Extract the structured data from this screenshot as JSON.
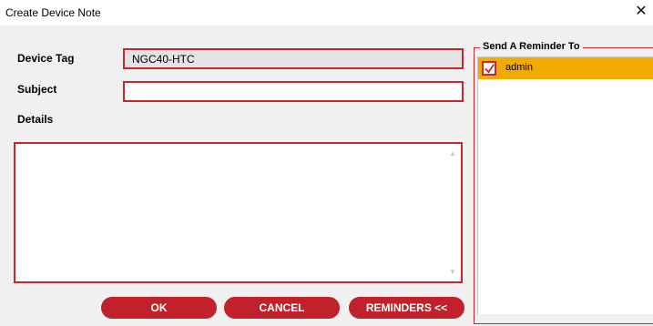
{
  "window": {
    "title": "Create Device Note"
  },
  "form": {
    "device_tag_label": "Device Tag",
    "device_tag_value": "NGC40-HTC",
    "subject_label": "Subject",
    "subject_value": "",
    "details_label": "Details",
    "details_value": ""
  },
  "buttons": {
    "ok": "OK",
    "cancel": "CANCEL",
    "reminders": "REMINDERS <<"
  },
  "reminder": {
    "group_title": "Send A Reminder To",
    "users": [
      {
        "name": "admin",
        "checked": true
      }
    ]
  },
  "colors": {
    "accent_red": "#c0212a",
    "highlight_orange": "#f0aa00"
  }
}
